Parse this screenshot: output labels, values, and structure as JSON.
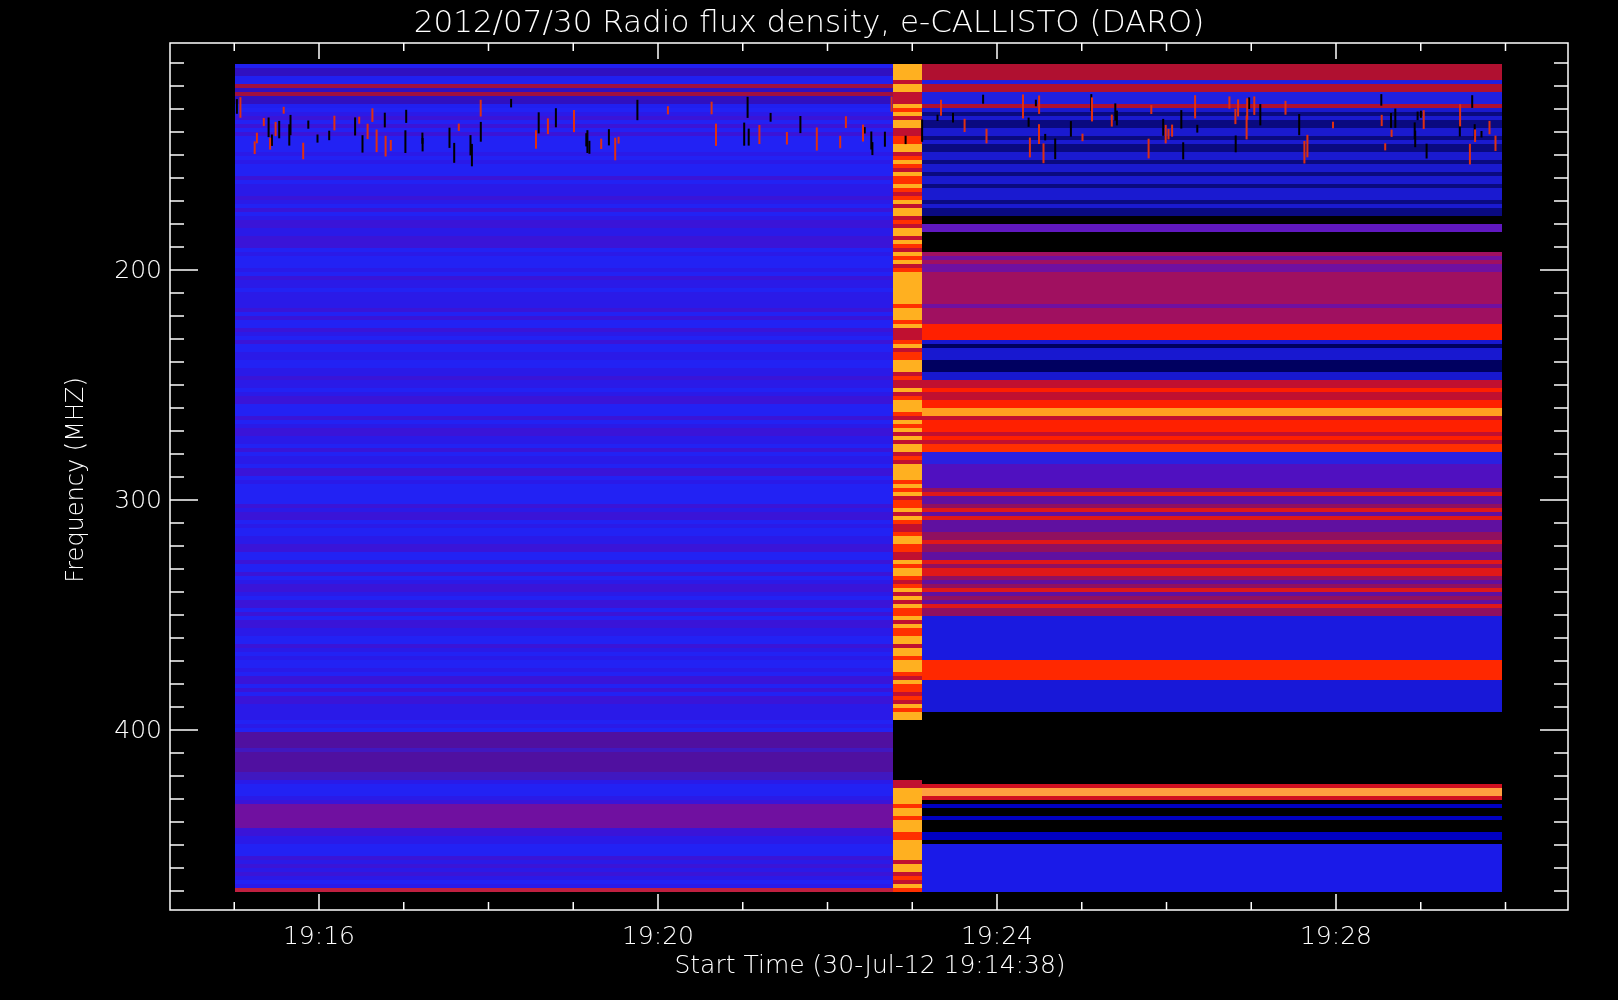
{
  "title": "2012/07/30  Radio flux density, e-CALLISTO (DARO)",
  "y_axis": {
    "label": "Frequency (MHZ)",
    "ticks": [
      "200",
      "300",
      "400"
    ]
  },
  "x_axis": {
    "label": "Start Time (30-Jul-12 19:14:38)",
    "ticks": [
      "19:16",
      "19:20",
      "19:24",
      "19:28"
    ]
  }
}
